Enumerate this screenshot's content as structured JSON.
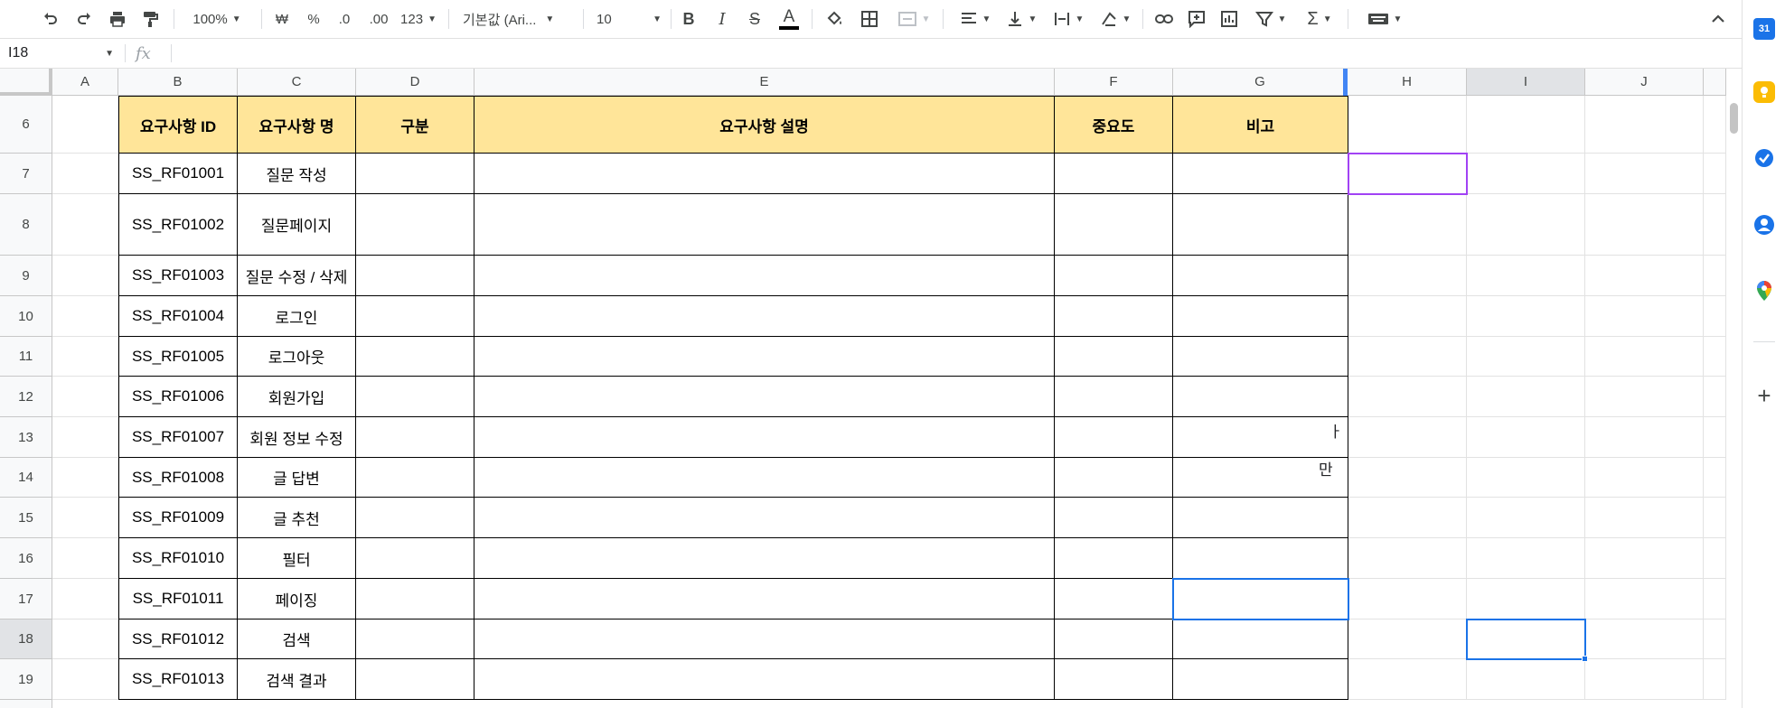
{
  "toolbar": {
    "zoom": "100%",
    "currency": "₩",
    "percent": "%",
    "dec_decrease": ".0",
    "dec_increase": ".00",
    "number_format": "123",
    "font_name": "기본값 (Ari...",
    "font_size": "10",
    "bold": "B",
    "italic": "I",
    "strikethrough": "S",
    "text_color": "A",
    "sum": "Σ"
  },
  "formula_bar": {
    "name_box": "I18",
    "fx": "fx",
    "value": ""
  },
  "columns": [
    "A",
    "B",
    "C",
    "D",
    "E",
    "F",
    "G",
    "H",
    "I",
    "J"
  ],
  "rows": [
    "6",
    "7",
    "8",
    "9",
    "10",
    "11",
    "12",
    "13",
    "14",
    "15",
    "16",
    "17",
    "18",
    "19"
  ],
  "table": {
    "headers": {
      "id": "요구사항 ID",
      "name": "요구사항 명",
      "category": "구분",
      "description": "요구사항 설명",
      "priority": "중요도",
      "note": "비고"
    },
    "rows": [
      {
        "id": "SS_RF01001",
        "name": "질문 작성"
      },
      {
        "id": "SS_RF01002",
        "name": "질문페이지"
      },
      {
        "id": "SS_RF01003",
        "name": "질문 수정 / 삭제"
      },
      {
        "id": "SS_RF01004",
        "name": "로그인"
      },
      {
        "id": "SS_RF01005",
        "name": "로그아웃"
      },
      {
        "id": "SS_RF01006",
        "name": "회원가입"
      },
      {
        "id": "SS_RF01007",
        "name": "회원 정보 수정"
      },
      {
        "id": "SS_RF01008",
        "name": "글 답변"
      },
      {
        "id": "SS_RF01009",
        "name": "글 추천"
      },
      {
        "id": "SS_RF01010",
        "name": "필터"
      },
      {
        "id": "SS_RF01011",
        "name": "페이징"
      },
      {
        "id": "SS_RF01012",
        "name": "검색"
      },
      {
        "id": "SS_RF01013",
        "name": "검색 결과"
      }
    ]
  },
  "fragments": {
    "g13": "ㅏ",
    "g14": "만"
  },
  "sidebar": {
    "calendar_label": "31",
    "add": "+"
  },
  "colors": {
    "header_fill": "#ffe599",
    "selection": "#1a73e8",
    "purple_selection": "#a142f4"
  }
}
